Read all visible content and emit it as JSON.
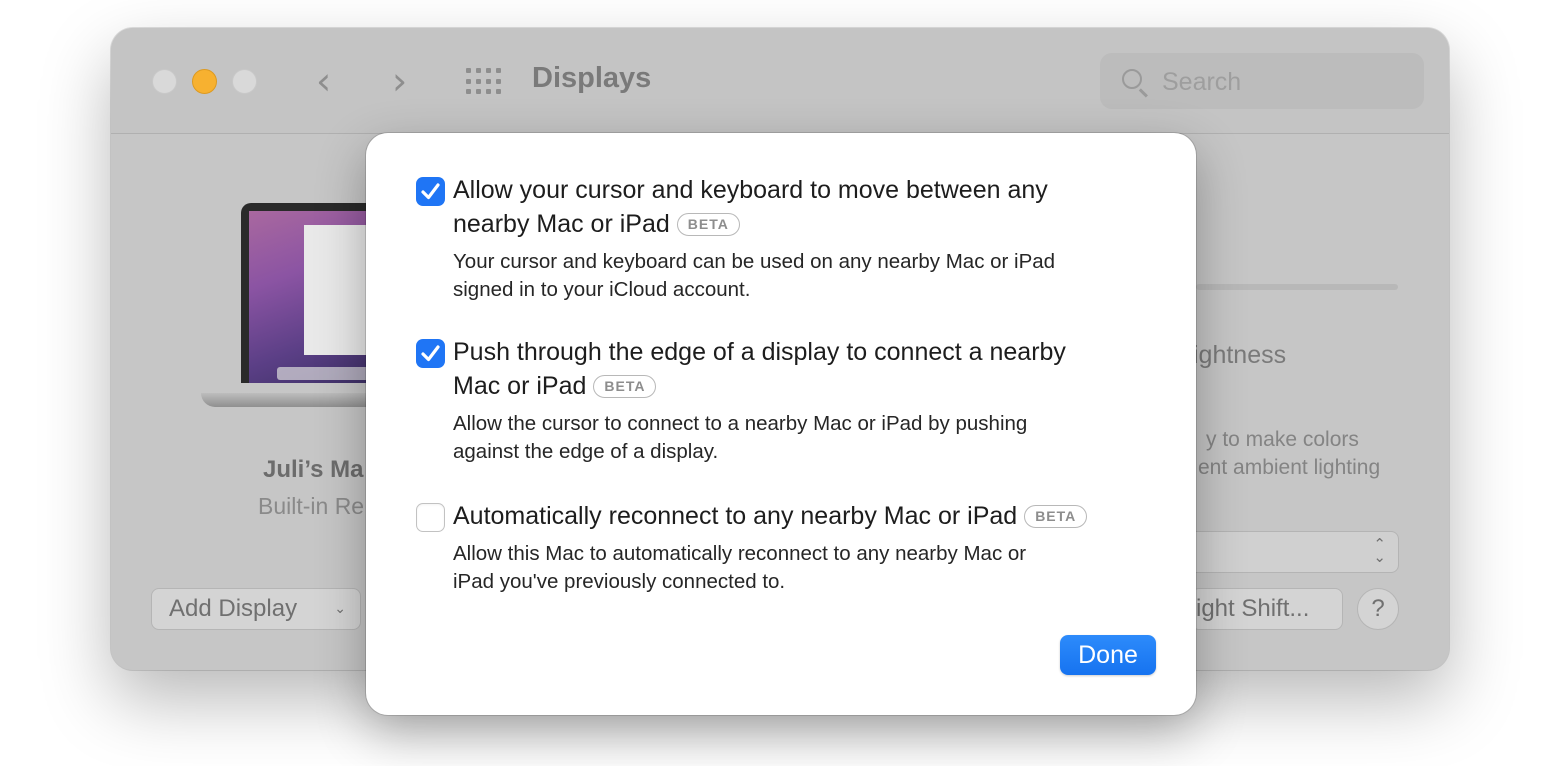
{
  "window": {
    "title": "Displays",
    "search_placeholder": "Search"
  },
  "background": {
    "device_name": "Juli’s Ma",
    "device_sub": "Built-in Re",
    "add_display_label": "Add Display",
    "brightness_fragment": "ightness",
    "true_tone_line1": "y to make colors",
    "true_tone_line2": "ent ambient lighting",
    "night_shift_label": "ight Shift...",
    "help_label": "?"
  },
  "sheet": {
    "options": [
      {
        "checked": true,
        "title_line1": "Allow your cursor and keyboard to move between any",
        "title_line2": "nearby Mac or iPad",
        "badge": "BETA",
        "desc_line1": "Your cursor and keyboard can be used on any nearby Mac or iPad",
        "desc_line2": "signed in to your iCloud account."
      },
      {
        "checked": true,
        "title_line1": "Push through the edge of a display to connect a nearby",
        "title_line2": "Mac or iPad",
        "badge": "BETA",
        "desc_line1": "Allow the cursor to connect to a nearby Mac or iPad by pushing",
        "desc_line2": "against the edge of a display."
      },
      {
        "checked": false,
        "title_line1": "Automatically reconnect to any nearby Mac or iPad",
        "badge": "BETA",
        "desc_line1": "Allow this Mac to automatically reconnect to any nearby Mac or",
        "desc_line2": "iPad you've previously connected to."
      }
    ],
    "done_label": "Done"
  },
  "colors": {
    "accent": "#1f75f5",
    "minimize_light": "#f7b130"
  }
}
